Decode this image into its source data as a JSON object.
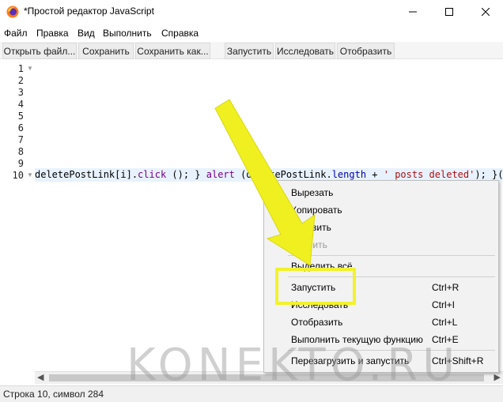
{
  "window": {
    "title": "*Простой редактор JavaScript",
    "app_icon": "firefox-icon"
  },
  "menu": {
    "items": [
      "Файл",
      "Правка",
      "Вид",
      "Выполнить",
      "Справка"
    ]
  },
  "toolbar": {
    "buttons": [
      "Открыть файл...",
      "Сохранить",
      "Сохранить как...",
      "Запустить",
      "Исследовать",
      "Отобразить"
    ]
  },
  "editor": {
    "line_numbers": [
      "1",
      "2",
      "3",
      "4",
      "5",
      "6",
      "7",
      "8",
      "9",
      "10"
    ],
    "code_parts": {
      "p1": "deletePostLink[i].",
      "p2": "click",
      "p3": " (); } ",
      "p4": "alert",
      "p5": " (deletePostLink.",
      "p6": "length",
      "p7": " + ",
      "p8": "' posts deleted'",
      "p9": "); }());"
    }
  },
  "context_menu": {
    "items": [
      {
        "label": "Вырезать",
        "shortcut": ""
      },
      {
        "label": "Копировать",
        "shortcut": ""
      },
      {
        "label": "Вставить",
        "shortcut": ""
      },
      {
        "label": "Удалить",
        "shortcut": ""
      },
      {
        "label": "Выделить всё",
        "shortcut": ""
      },
      {
        "label": "Запустить",
        "shortcut": "Ctrl+R"
      },
      {
        "label": "Исследовать",
        "shortcut": "Ctrl+I"
      },
      {
        "label": "Отобразить",
        "shortcut": "Ctrl+L"
      },
      {
        "label": "Выполнить текущую функцию",
        "shortcut": "Ctrl+E"
      },
      {
        "label": "Перезагрузить и запустить",
        "shortcut": "Ctrl+Shift+R"
      }
    ]
  },
  "status": {
    "text": "Строка 10, символ 284"
  },
  "watermark": "KONEKTO.RU",
  "colors": {
    "highlight_yellow": "#f2f22a",
    "arrow_yellow": "#f0f020"
  }
}
